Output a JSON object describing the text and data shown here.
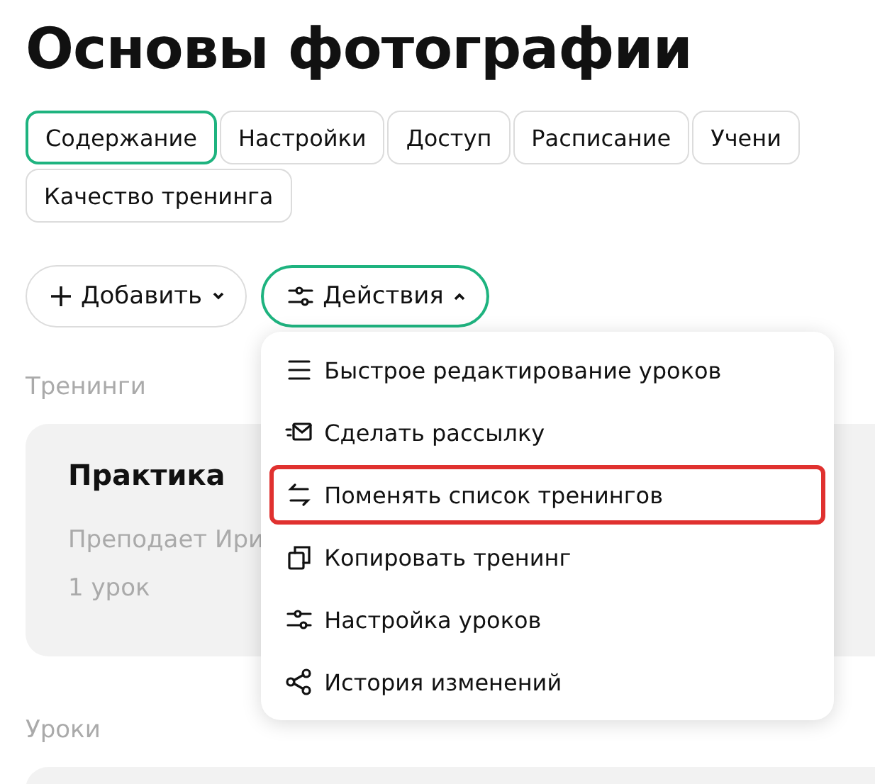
{
  "title": "Основы фотографии",
  "tabs": [
    {
      "label": "Содержание",
      "selected": true
    },
    {
      "label": "Настройки",
      "selected": false
    },
    {
      "label": "Доступ",
      "selected": false
    },
    {
      "label": "Расписание",
      "selected": false
    },
    {
      "label": "Учени",
      "selected": false
    },
    {
      "label": "Качество тренинга",
      "selected": false
    }
  ],
  "toolbar": {
    "add_button": {
      "label": "Добавить",
      "expanded": false
    },
    "actions_button": {
      "label": "Действия",
      "expanded": true
    }
  },
  "actions_menu": [
    {
      "kind": "lines",
      "label": "Быстрое редактирование уроков",
      "highlighted": false
    },
    {
      "kind": "mail",
      "label": "Сделать рассылку",
      "highlighted": false
    },
    {
      "kind": "swap",
      "label": "Поменять список тренингов",
      "highlighted": true
    },
    {
      "kind": "copy",
      "label": "Копировать тренинг",
      "highlighted": false
    },
    {
      "kind": "sliders",
      "label": "Настройка уроков",
      "highlighted": false
    },
    {
      "kind": "share",
      "label": "История изменений",
      "highlighted": false
    }
  ],
  "trainings": {
    "heading": "Тренинги",
    "cards": [
      {
        "title": "Практика",
        "teacher": "Преподает Ири",
        "lessons": "1 урок"
      }
    ]
  },
  "lessons": {
    "heading": "Уроки"
  }
}
